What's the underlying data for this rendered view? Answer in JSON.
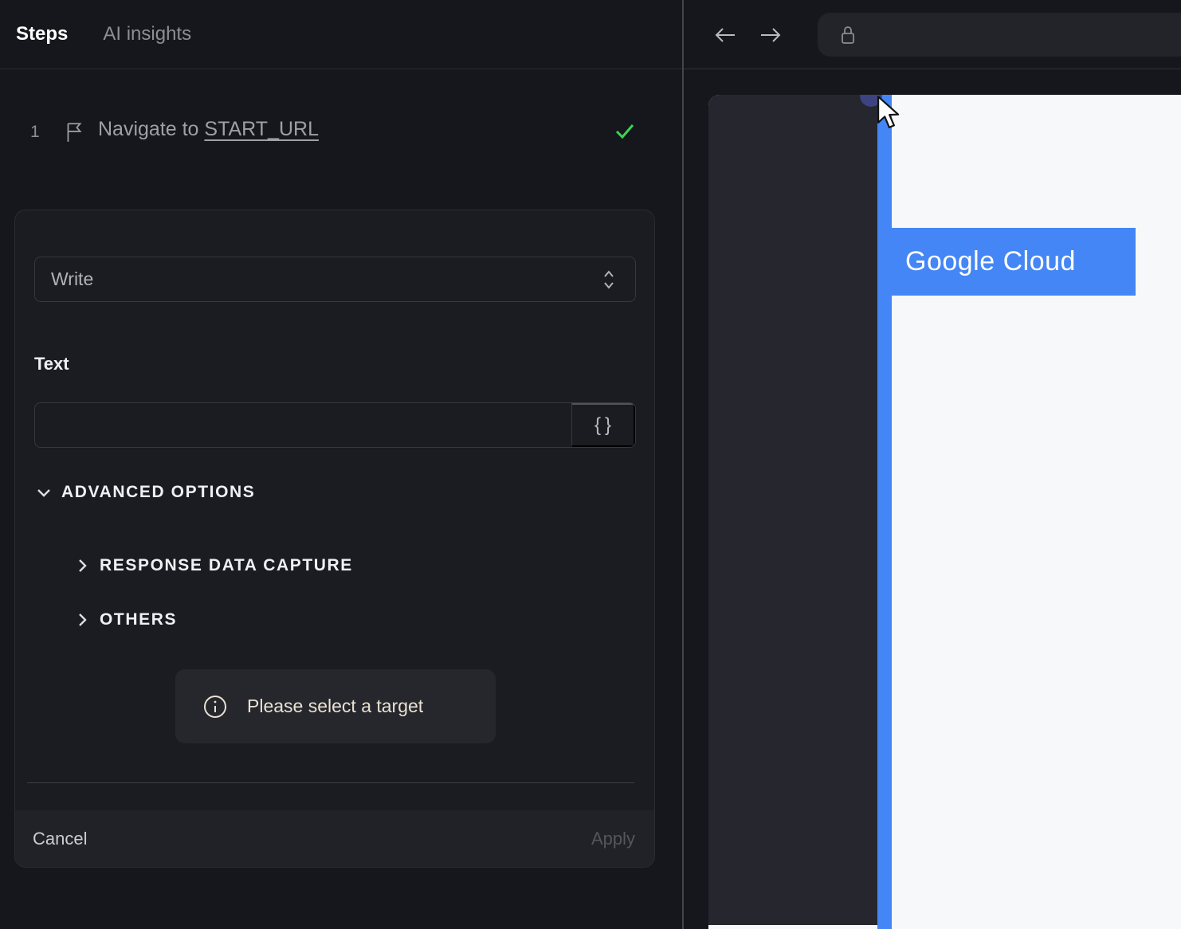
{
  "left_panel": {
    "tabs": [
      {
        "label": "Steps",
        "active": true
      },
      {
        "label": "AI insights",
        "active": false
      }
    ],
    "step": {
      "number": "1",
      "text": "Navigate to ",
      "link": "START_URL",
      "status": "success"
    },
    "editor": {
      "action": {
        "value": "Write"
      },
      "text_field": {
        "label": "Text",
        "value": "",
        "variable_button": "{}"
      },
      "advanced_options_label": "ADVANCED OPTIONS",
      "subsections": [
        {
          "label": "RESPONSE DATA CAPTURE"
        },
        {
          "label": "OTHERS"
        }
      ],
      "notice": {
        "text": "Please select a target"
      },
      "footer": {
        "cancel": "Cancel",
        "apply": "Apply",
        "apply_enabled": false
      }
    }
  },
  "right_panel": {
    "url_bar": {
      "value": ""
    },
    "page": {
      "hero_text": "Google Cloud"
    }
  },
  "icons": {
    "flag": "flag-icon",
    "check": "check-icon",
    "unfold": "chevron-up-down-icon",
    "chevron_down": "chevron-down-icon",
    "chevron_right": "chevron-right-icon",
    "info": "info-icon",
    "back": "arrow-left-icon",
    "forward": "arrow-right-icon",
    "lock": "lock-icon",
    "cursor": "cursor-pointer-icon"
  },
  "colors": {
    "panel_bg": "#16171c",
    "card_bg": "#1b1c22",
    "accent_blue": "#4486f5",
    "success_green": "#3dd353",
    "notice_text": "#eae2d3",
    "page_bg": "#f7f8f9",
    "hero_dark": "#25262e",
    "target_dot": "#3c4380"
  }
}
